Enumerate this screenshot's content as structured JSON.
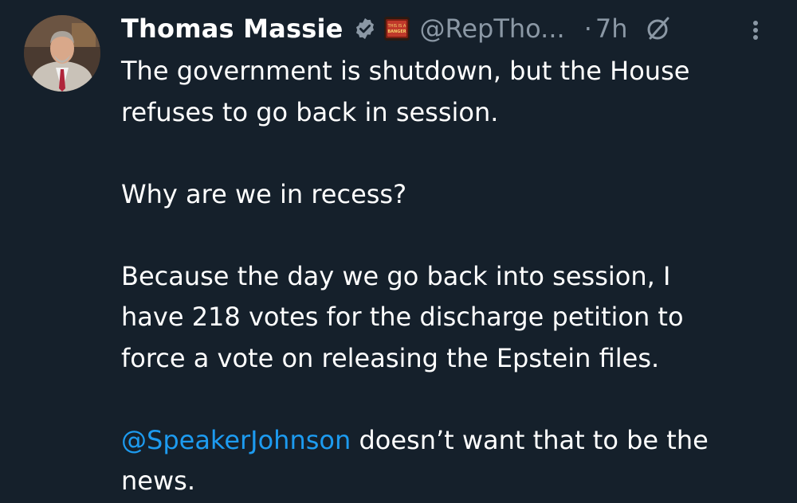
{
  "tweet": {
    "author": {
      "display_name": "Thomas Massie",
      "handle": "@RepTho...",
      "verified_icon": "verified-badge-icon",
      "affiliate_badge_text": "THIS IS A BANGER"
    },
    "separator": "·",
    "timestamp": "7h",
    "grok_icon": "grok-slash-circle-icon",
    "more_icon": "vertical-ellipsis-icon",
    "paragraphs": [
      {
        "lines": [
          "The government is shutdown, but the House",
          "refuses to go back in session."
        ]
      },
      {
        "lines": [
          "Why are we in recess?"
        ]
      },
      {
        "lines": [
          "Because the day we go back into session, I",
          "have 218 votes for the discharge petition to",
          "force a vote on releasing the Epstein files."
        ]
      }
    ],
    "last_paragraph": {
      "mention": "@SpeakerJohnson",
      "rest_line1": " doesn’t want that to be the",
      "line2": "news."
    }
  },
  "colors": {
    "background": "#15202b",
    "text": "#ffffff",
    "muted": "#8b98a5",
    "link": "#1d9bf0"
  }
}
